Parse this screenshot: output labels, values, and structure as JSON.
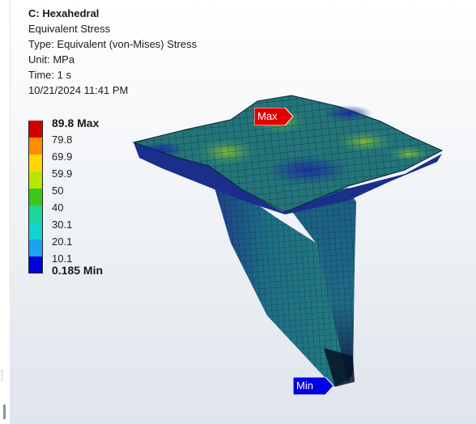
{
  "result_header": {
    "title": "C: Hexahedral",
    "result_name": "Equivalent Stress",
    "type": "Type: Equivalent (von-Mises) Stress",
    "unit": "Unit: MPa",
    "time": "Time: 1 s",
    "timestamp": "10/21/2024 11:41 PM"
  },
  "legend": {
    "entries": [
      {
        "label": "89.8 Max",
        "color": "#d10000",
        "bold": true
      },
      {
        "label": "79.8",
        "color": "#ff8c00",
        "bold": false
      },
      {
        "label": "69.9",
        "color": "#ffd700",
        "bold": false
      },
      {
        "label": "59.9",
        "color": "#b8e600",
        "bold": false
      },
      {
        "label": "50",
        "color": "#3ec61a",
        "bold": false
      },
      {
        "label": "40",
        "color": "#1fd69a",
        "bold": false
      },
      {
        "label": "30.1",
        "color": "#14d3d3",
        "bold": false
      },
      {
        "label": "20.1",
        "color": "#1aa3f0",
        "bold": false
      },
      {
        "label": "10.1",
        "color": "#0000d8",
        "bold": false
      },
      {
        "label": "0.185 Min",
        "color": null,
        "bold": true
      }
    ]
  },
  "probes": {
    "max_label": "Max",
    "min_label": "Min",
    "max_color": "#e00000",
    "min_color": "#0000e0"
  }
}
